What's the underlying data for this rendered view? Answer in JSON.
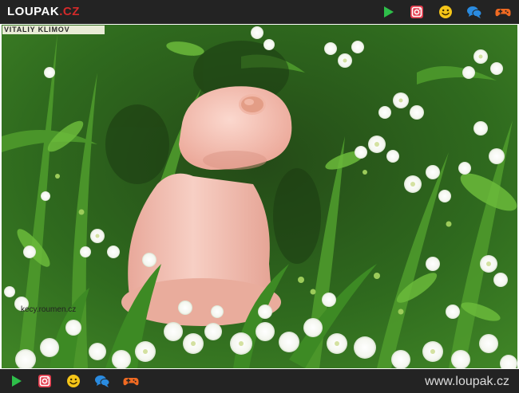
{
  "header": {
    "logo_name": "LOUPAK",
    "logo_tld": ".CZ",
    "icons": [
      "play-icon",
      "instagram-icon",
      "smiley-icon",
      "chat-bubbles-icon",
      "gamepad-icon"
    ]
  },
  "photo": {
    "credit": "VITALIY KLIMOV",
    "watermark": "kecy.roumen.cz"
  },
  "footer": {
    "site_url": "www.loupak.cz",
    "icons": [
      "play-icon",
      "instagram-icon",
      "smiley-icon",
      "chat-bubbles-icon",
      "gamepad-icon"
    ]
  },
  "colors": {
    "bar_background": "#232323",
    "logo_accent": "#d42a2a",
    "play": "#2ebf4a",
    "instagram": "#e33d4e",
    "smiley": "#f5c518",
    "chat": "#2a8be0",
    "gamepad": "#f06a22"
  }
}
